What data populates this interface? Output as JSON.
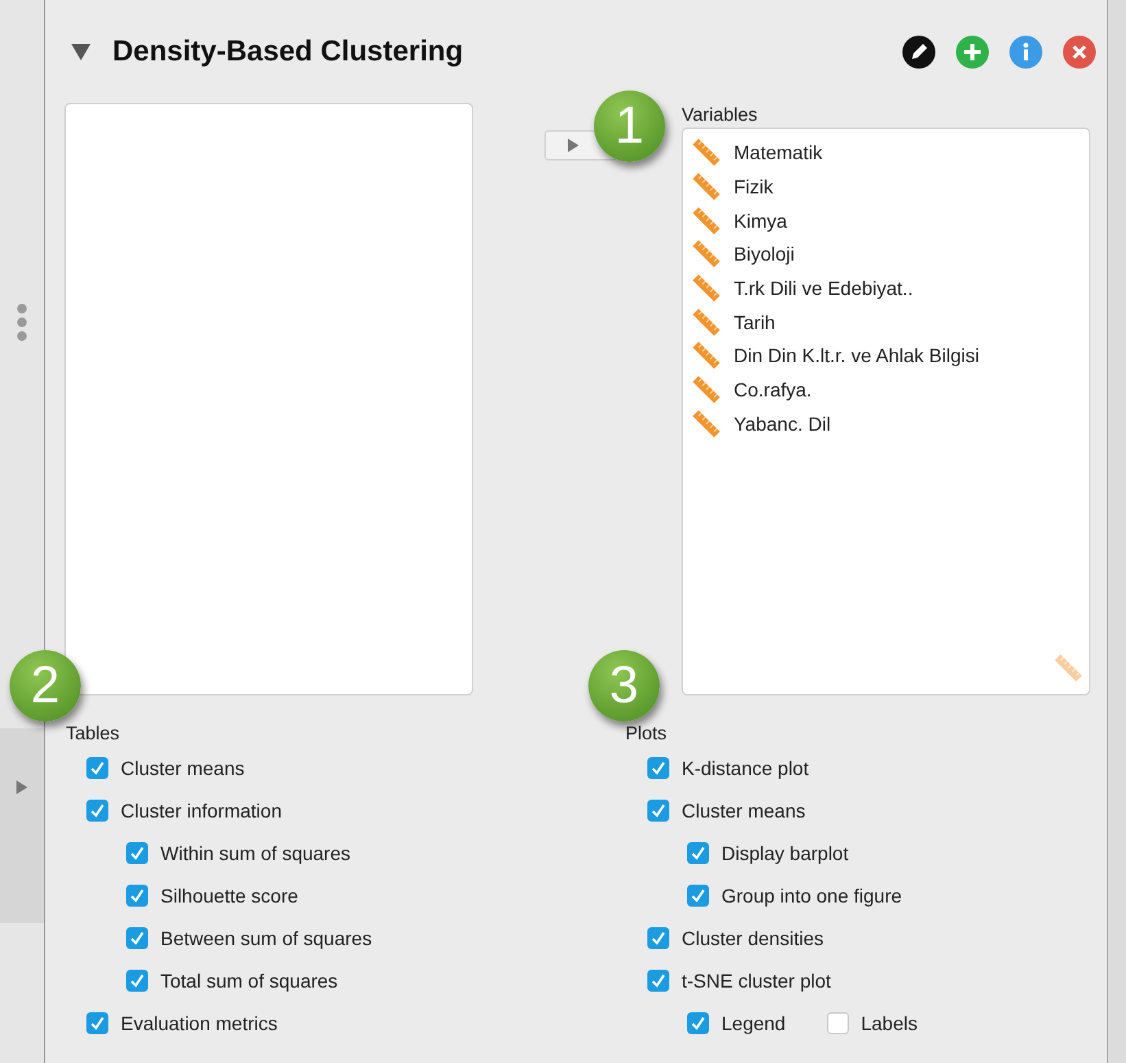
{
  "panel": {
    "title": "Density-Based Clustering",
    "expanded": true
  },
  "variables": {
    "label": "Variables",
    "items": [
      "Matematik",
      "Fizik",
      "Kimya",
      "Biyoloji",
      "T.rk Dili ve Edebiyat..",
      "Tarih",
      "Din Din K.lt.r. ve Ahlak Bilgisi",
      "Co.rafya.",
      "Yabanc. Dil"
    ]
  },
  "tables": {
    "label": "Tables",
    "options": [
      {
        "label": "Cluster means",
        "checked": true
      },
      {
        "label": "Cluster information",
        "checked": true,
        "children": [
          {
            "label": "Within sum of squares",
            "checked": true
          },
          {
            "label": "Silhouette score",
            "checked": true
          },
          {
            "label": "Between sum of squares",
            "checked": true
          },
          {
            "label": "Total sum of squares",
            "checked": true
          }
        ]
      },
      {
        "label": "Evaluation metrics",
        "checked": true
      }
    ]
  },
  "plots": {
    "label": "Plots",
    "options": [
      {
        "label": "K-distance plot",
        "checked": true
      },
      {
        "label": "Cluster means",
        "checked": true,
        "children": [
          {
            "label": "Display barplot",
            "checked": true
          },
          {
            "label": "Group into one figure",
            "checked": true
          }
        ]
      },
      {
        "label": "Cluster densities",
        "checked": true
      },
      {
        "label": "t-SNE cluster plot",
        "checked": true,
        "inline_children": [
          {
            "label": "Legend",
            "checked": true
          },
          {
            "label": "Labels",
            "checked": false
          }
        ]
      }
    ]
  },
  "badges": [
    "1",
    "2",
    "3"
  ]
}
